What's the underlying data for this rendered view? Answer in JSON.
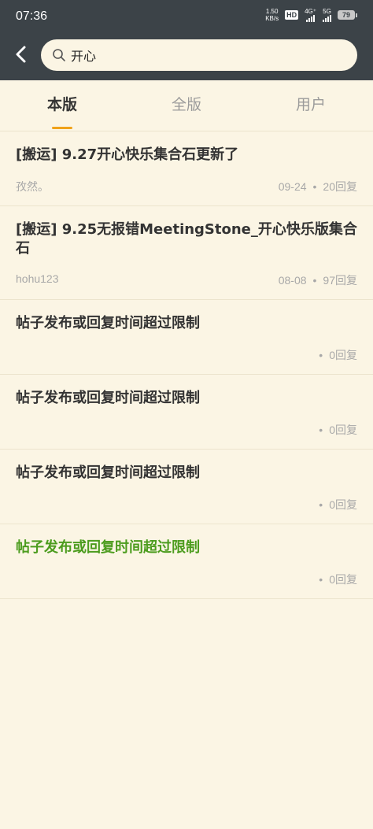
{
  "status_bar": {
    "time": "07:36",
    "speed_value": "1.50",
    "speed_unit": "KB/s",
    "hd_label": "HD",
    "network_1": "4G⁺",
    "network_2": "5G",
    "battery": "79"
  },
  "search": {
    "query": "开心"
  },
  "tabs": [
    {
      "label": "本版",
      "active": true
    },
    {
      "label": "全版",
      "active": false
    },
    {
      "label": "用户",
      "active": false
    }
  ],
  "posts": [
    {
      "title": "[搬运] 9.27开心快乐集合石更新了",
      "author": "孜然。",
      "date": "09-24",
      "replies": "20回复"
    },
    {
      "title": "[搬运] 9.25无报错MeetingStone_开心快乐版集合石",
      "author": "hohu123",
      "date": "08-08",
      "replies": "97回复"
    },
    {
      "title": "帖子发布或回复时间超过限制",
      "author": "",
      "date": "",
      "replies": "0回复"
    },
    {
      "title": "帖子发布或回复时间超过限制",
      "author": "",
      "date": "",
      "replies": "0回复"
    },
    {
      "title": "帖子发布或回复时间超过限制",
      "author": "",
      "date": "",
      "replies": "0回复"
    },
    {
      "title": "帖子发布或回复时间超过限制",
      "author": "",
      "date": "",
      "replies": "0回复"
    }
  ],
  "colors": {
    "header_bg": "#3c4348",
    "page_bg": "#fbf5e4",
    "tab_indicator": "#f0a21a",
    "highlight_title": "#4c9c1e"
  }
}
